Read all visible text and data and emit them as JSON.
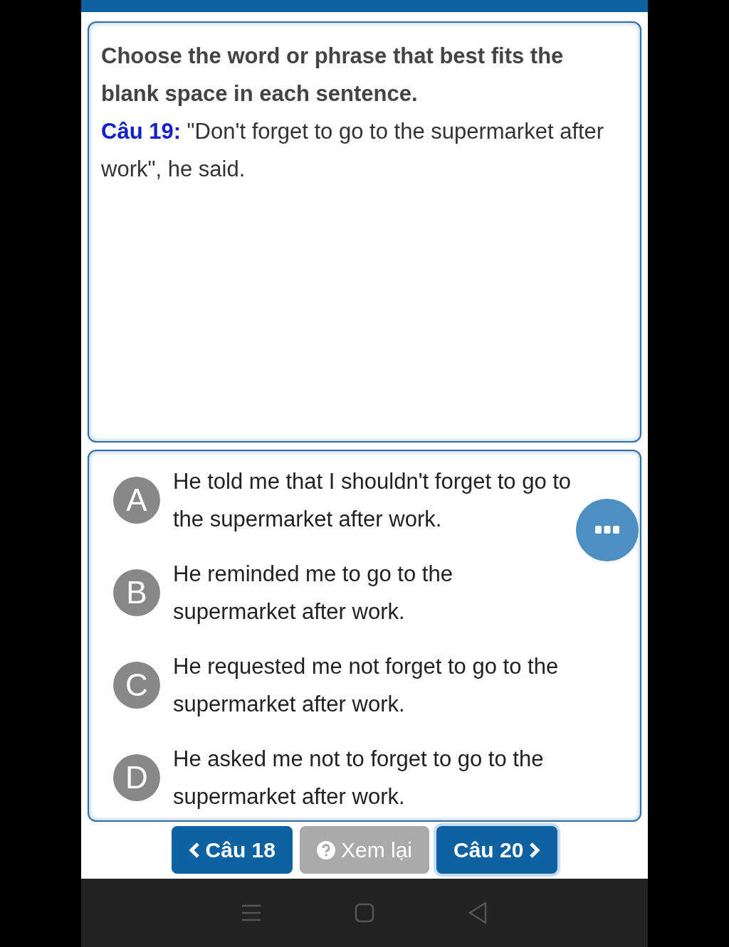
{
  "question": {
    "instruction": "Choose the word or phrase that best fits the blank space in each sentence.",
    "label": "Câu 19:",
    "text": "\"Don't forget to go to the supermarket after work\", he said."
  },
  "options": [
    {
      "letter": "A",
      "text": "He told me that I shouldn't forget to go to the supermarket after work."
    },
    {
      "letter": "B",
      "text": "He reminded me to go to the supermarket after work."
    },
    {
      "letter": "C",
      "text": "He requested me not forget to go to the supermarket after work."
    },
    {
      "letter": "D",
      "text": "He asked me not to forget to go to the supermarket after work."
    }
  ],
  "buttons": [
    {
      "kind": "prev",
      "label": "Câu 18",
      "disabled": false,
      "focused": false
    },
    {
      "kind": "review",
      "label": "Xem lại",
      "disabled": true,
      "focused": false
    },
    {
      "kind": "next",
      "label": "Câu 20",
      "disabled": false,
      "focused": true
    }
  ]
}
